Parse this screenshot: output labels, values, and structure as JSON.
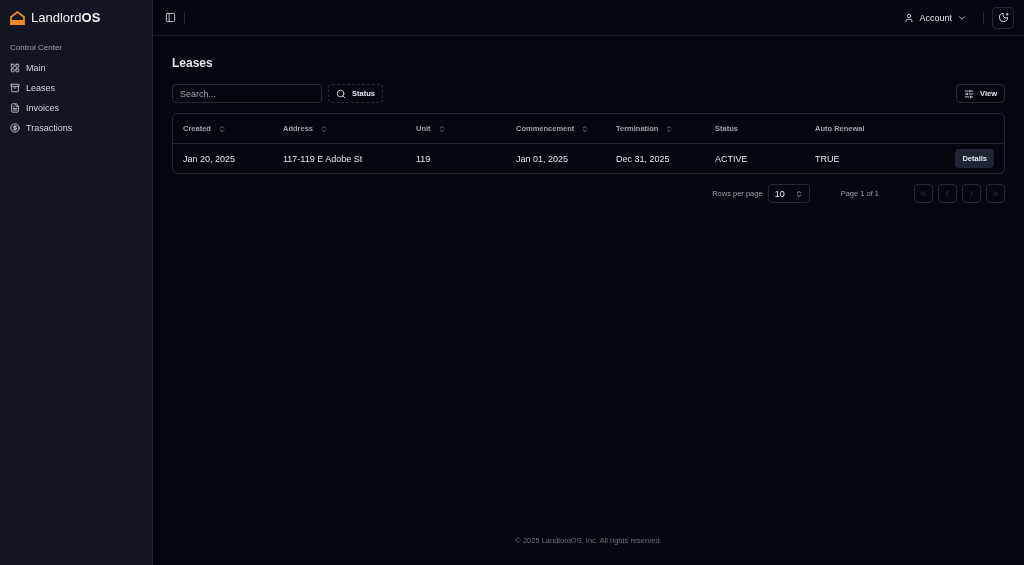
{
  "sidebar": {
    "logo": "Landlord**OS**",
    "section": "Control Center",
    "items": [
      {
        "label": "Main",
        "selected": false
      },
      {
        "label": "Leases",
        "selected": false
      },
      {
        "label": "Invoices",
        "selected": false
      },
      {
        "label": "Trasactions",
        "selected": false
      }
    ]
  },
  "header": {
    "account": "Account"
  },
  "page": {
    "title": "Leases",
    "search": {
      "placeholder": "Search..."
    },
    "filter": "Status",
    "view": "View"
  },
  "table": {
    "columns": [
      {
        "label": "Created",
        "sortable": true
      },
      {
        "label": "Address",
        "sortable": true
      },
      {
        "label": "Unit",
        "sortable": true
      },
      {
        "label": "Commencement",
        "sortable": true
      },
      {
        "label": "Termination",
        "sortable": true
      },
      {
        "label": "Status",
        "sortable": false
      },
      {
        "label": "Auto Renewal",
        "sortable": false
      }
    ],
    "rows": [
      {
        "cells": [
          "Jan 20, 2025",
          "117-119 E Adobe St",
          "119",
          "Jan 01, 2025",
          "Dec 31, 2025",
          "ACTIVE",
          "TRUE"
        ],
        "action": "Details"
      }
    ]
  },
  "pagination": {
    "rows_label": "Rows per page",
    "rows_value": "10",
    "page": "Page 1 of 1",
    "buttons": [
      {
        "disabled": true
      },
      {
        "disabled": true
      },
      {
        "disabled": true
      },
      {
        "disabled": true
      }
    ]
  },
  "footer": "© 2025 LandlordOS, Inc. All rights reserved."
}
